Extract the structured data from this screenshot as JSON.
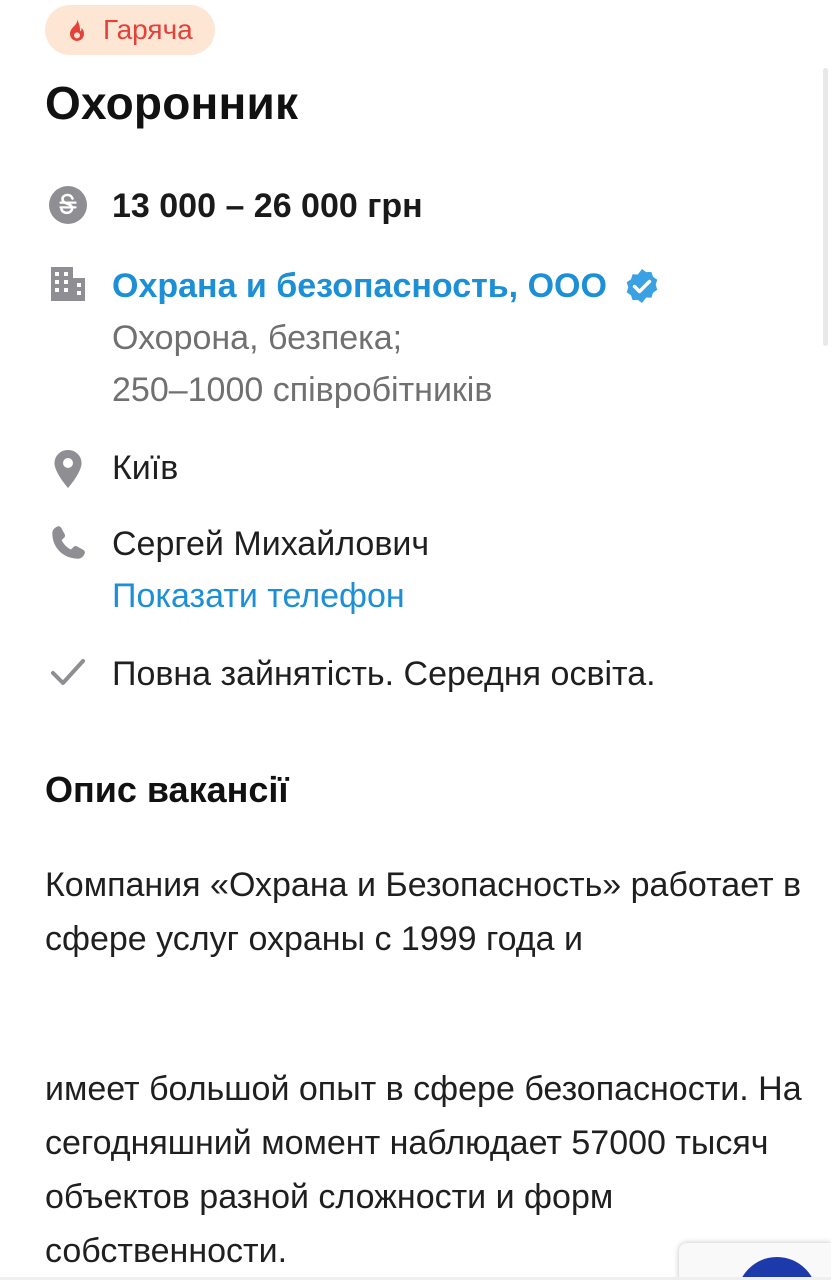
{
  "badge": {
    "label": "Гаряча",
    "icon": "flame-icon",
    "color": "#e5403a",
    "background": "#fde6d4"
  },
  "vacancy": {
    "title": "Охоронник",
    "salary": "13 000 – 26 000 грн",
    "company": {
      "name": "Охрана и безопасность, ООО",
      "verified_icon": "verified-check-icon",
      "industry": "Охорона, безпека;",
      "size": "250–1000 співробітників"
    },
    "location": "Київ",
    "contact": {
      "name": "Сергей Михайлович",
      "show_phone_label": "Показати телефон"
    },
    "conditions": "Повна зайнятість. Середня освіта."
  },
  "description": {
    "heading": "Опис вакансії",
    "paragraphs": [
      "Компания «Охрана и Безопасность» работает в сфере услуг охраны с 1999 года и",
      "имеет большой опыт в сфере безопасности. На сегодняшний момент наблюдает 57000 тысяч объектов разной сложности и форм собственности."
    ]
  },
  "colors": {
    "accent": "#1c8fd6",
    "icon_gray": "#8e8e93",
    "muted_text": "#707070"
  }
}
